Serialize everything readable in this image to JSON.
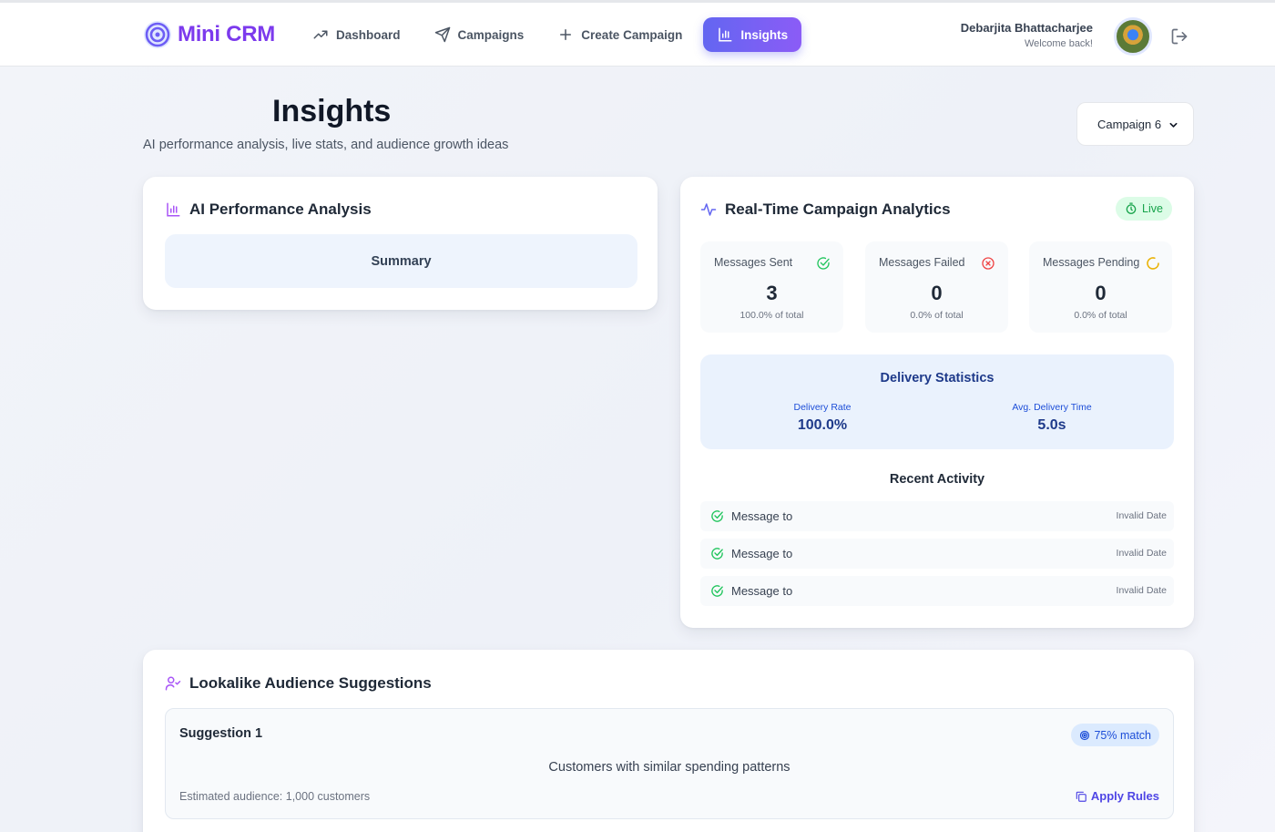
{
  "app": {
    "name": "Mini CRM",
    "logo_icon": "target-icon",
    "brand_color": "#7c3aed"
  },
  "nav": [
    {
      "label": "Dashboard",
      "icon": "trending-up-icon",
      "active": false
    },
    {
      "label": "Campaigns",
      "icon": "send-icon",
      "active": false
    },
    {
      "label": "Create Campaign",
      "icon": "plus-icon",
      "active": false
    },
    {
      "label": "Insights",
      "icon": "bar-chart-icon",
      "active": true
    }
  ],
  "user": {
    "name": "Debarjita Bhattacharjee",
    "greeting": "Welcome back!",
    "logout_icon": "logout-icon"
  },
  "page": {
    "title": "Insights",
    "subtitle": "AI performance analysis, live stats, and audience growth ideas"
  },
  "campaign_select": {
    "value": "Campaign 6"
  },
  "ai_analysis": {
    "title": "AI Performance Analysis",
    "summary": "Summary"
  },
  "realtime": {
    "title": "Real-Time Campaign Analytics",
    "live_label": "Live",
    "stats": [
      {
        "label": "Messages Sent",
        "value": "3",
        "pct": "100.0% of total",
        "icon": "check-circle-icon",
        "color": "#22c55e"
      },
      {
        "label": "Messages Failed",
        "value": "0",
        "pct": "0.0% of total",
        "icon": "x-circle-icon",
        "color": "#ef4444"
      },
      {
        "label": "Messages Pending",
        "value": "0",
        "pct": "0.0% of total",
        "icon": "loader-icon",
        "color": "#eab308"
      }
    ],
    "delivery": {
      "title": "Delivery Statistics",
      "rate_label": "Delivery Rate",
      "rate_value": "100.0%",
      "time_label": "Avg. Delivery Time",
      "time_value": "5.0s"
    },
    "recent_title": "Recent Activity",
    "activity": [
      {
        "text": "Message to",
        "date": "Invalid Date"
      },
      {
        "text": "Message to",
        "date": "Invalid Date"
      },
      {
        "text": "Message to",
        "date": "Invalid Date"
      }
    ]
  },
  "lookalike": {
    "title": "Lookalike Audience Suggestions",
    "suggestion": {
      "title": "Suggestion 1",
      "match": "75% match",
      "description": "Customers with similar spending patterns",
      "estimate": "Estimated audience: 1,000 customers",
      "apply_label": "Apply Rules"
    }
  }
}
